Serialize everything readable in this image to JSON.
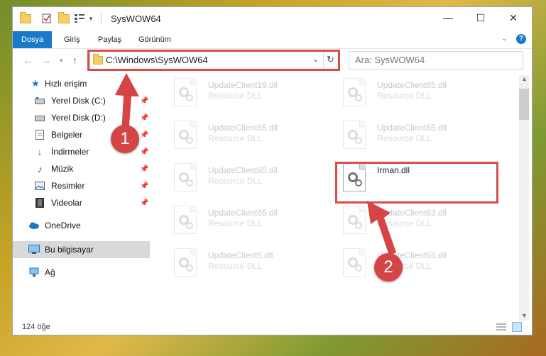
{
  "window": {
    "title": "SysWOW64",
    "minimize": "—",
    "maximize": "☐",
    "close": "✕"
  },
  "ribbon": {
    "tabs": [
      "Dosya",
      "Giriş",
      "Paylaş",
      "Görünüm"
    ],
    "help": "?"
  },
  "nav": {
    "address": "C:\\Windows\\SysWOW64",
    "search_placeholder": "Ara: SysWOW64"
  },
  "sidebar": {
    "items": [
      {
        "label": "Hızlı erişim",
        "icon": "star-icon"
      },
      {
        "label": "Yerel Disk (C:)",
        "icon": "disk-icon",
        "pinned": true
      },
      {
        "label": "Yerel Disk (D:)",
        "icon": "disk-icon",
        "pinned": true
      },
      {
        "label": "Belgeler",
        "icon": "documents-icon",
        "pinned": true
      },
      {
        "label": "İndirmeler",
        "icon": "download-icon",
        "pinned": true
      },
      {
        "label": "Müzik",
        "icon": "music-icon",
        "pinned": true
      },
      {
        "label": "Resimler",
        "icon": "pictures-icon",
        "pinned": true
      },
      {
        "label": "Videolar",
        "icon": "videos-icon",
        "pinned": true
      },
      {
        "label": "OneDrive",
        "icon": "cloud-icon"
      },
      {
        "label": "Bu bilgisayar",
        "icon": "computer-icon",
        "selected": true
      },
      {
        "label": "Ağ",
        "icon": "network-icon"
      }
    ]
  },
  "files": [
    {
      "name": "UpdateClient19.dll",
      "desc": "Resource DLL"
    },
    {
      "name": "UpdateClient65.dll",
      "desc": "Resource DLL"
    },
    {
      "name": "UpdateClient65.dll",
      "desc": "Resource DLL"
    },
    {
      "name": "UpdateClient65.dll",
      "desc": "Resource DLL"
    },
    {
      "name": "UpdateClient65.dll",
      "desc": "Resource DLL"
    },
    {
      "name": "Irman.dll",
      "desc": ""
    },
    {
      "name": "UpdateClient65.dll",
      "desc": "Resource DLL"
    },
    {
      "name": "UpdateClient63.dll",
      "desc": "Resource DLL"
    },
    {
      "name": "UpdateClient5.dll",
      "desc": "Resource DLL"
    },
    {
      "name": "UpdateClient65.dll",
      "desc": "Resource DLL"
    }
  ],
  "status": {
    "count": "124 öğe"
  },
  "annotations": {
    "step1": "1",
    "step2": "2",
    "color": "#d64545"
  }
}
